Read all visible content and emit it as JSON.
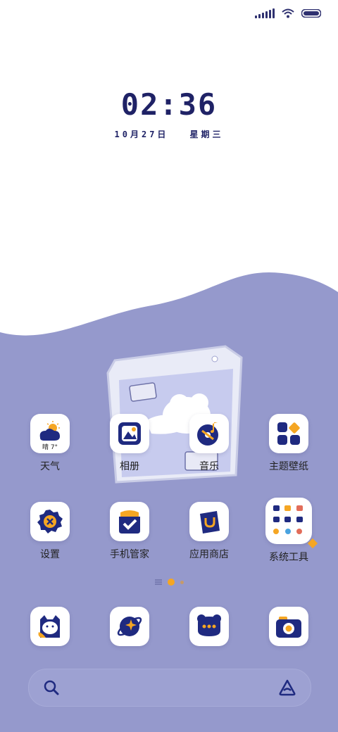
{
  "status_bar": {
    "icons": [
      "signal-icon",
      "wifi-icon",
      "battery-icon"
    ]
  },
  "clock": {
    "time": "02:36",
    "date": "10月27日",
    "weekday": "星期三"
  },
  "apps": [
    {
      "label": "天气",
      "icon": "weather-icon",
      "temp": "晴 7°"
    },
    {
      "label": "相册",
      "icon": "gallery-icon"
    },
    {
      "label": "音乐",
      "icon": "music-icon"
    },
    {
      "label": "主题壁纸",
      "icon": "themes-icon"
    },
    {
      "label": "设置",
      "icon": "settings-icon"
    },
    {
      "label": "手机管家",
      "icon": "security-icon"
    },
    {
      "label": "应用商店",
      "icon": "app-store-icon"
    },
    {
      "label": "系统工具",
      "icon": "folder-icon"
    }
  ],
  "dock": [
    {
      "icon": "cat-icon"
    },
    {
      "icon": "planet-icon"
    },
    {
      "icon": "chat-icon"
    },
    {
      "icon": "camera-icon"
    }
  ],
  "colors": {
    "background": "#9599cc",
    "accent": "#f5a623",
    "navy": "#1f2a80"
  }
}
